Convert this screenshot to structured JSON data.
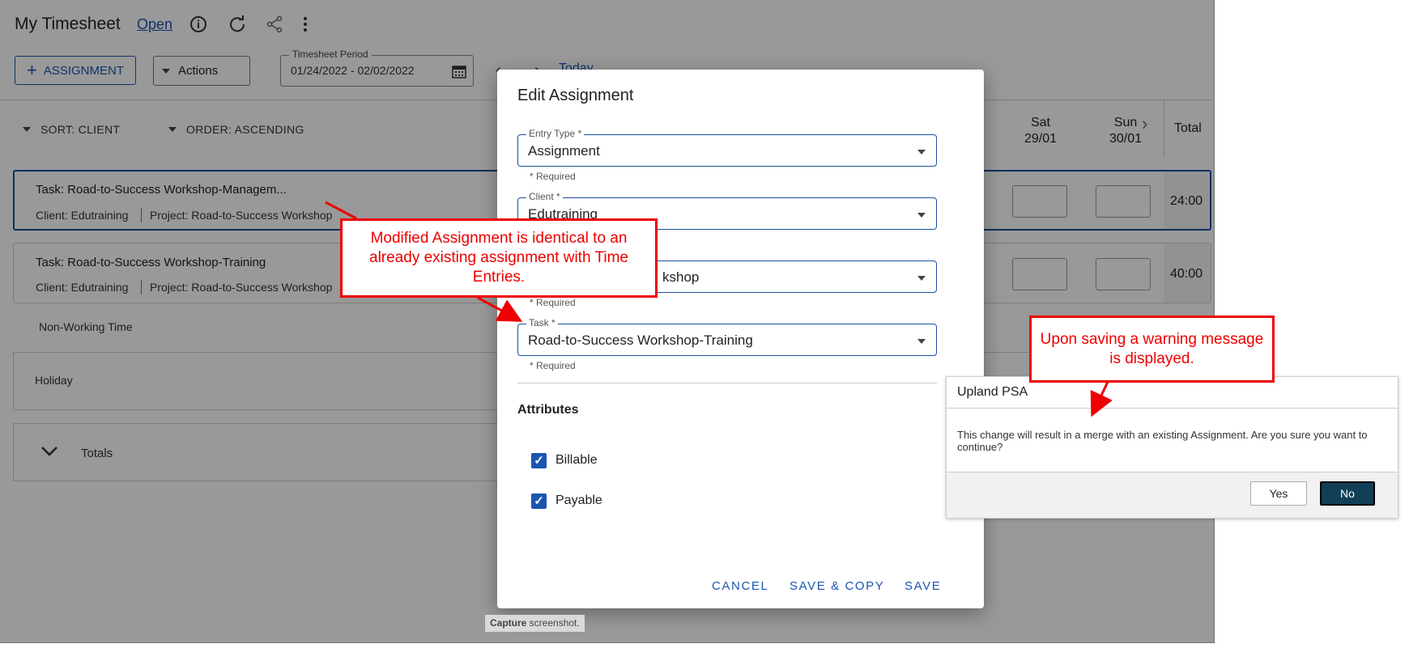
{
  "app": {
    "title": "My Timesheet",
    "status_link": "Open",
    "add_assignment": "ASSIGNMENT",
    "actions": "Actions",
    "period_label": "Timesheet Period",
    "period_value": "01/24/2022 - 02/02/2022",
    "today": "Today",
    "sort": "SORT: CLIENT",
    "order": "ORDER: ASCENDING",
    "columns": [
      {
        "day": "Sat",
        "date": "29/01"
      },
      {
        "day": "Sun",
        "date": "30/01"
      }
    ],
    "total_header": "Total",
    "rows": [
      {
        "task": "Task: Road-to-Success Workshop-Managem...",
        "client": "Client: Edutraining",
        "project": "Project: Road-to-Success Workshop",
        "total": "24:00"
      },
      {
        "task": "Task: Road-to-Success Workshop-Training",
        "client": "Client: Edutraining",
        "project": "Project: Road-to-Success Workshop",
        "total": "40:00"
      }
    ],
    "non_working": "Non-Working Time",
    "holiday": "Holiday",
    "totals": "Totals"
  },
  "dialog": {
    "title": "Edit Assignment",
    "entry_type_label": "Entry Type *",
    "entry_type_value": "Assignment",
    "client_label": "Client *",
    "client_value": "Edutraining",
    "project_value_visible": "kshop",
    "task_label": "Task *",
    "task_value": "Road-to-Success Workshop-Training",
    "required": "* Required",
    "attributes": "Attributes",
    "billable": "Billable",
    "payable": "Payable",
    "cancel": "CANCEL",
    "save_copy": "SAVE & COPY",
    "save": "SAVE"
  },
  "capture": {
    "bold": "Capture",
    "rest": " screenshot."
  },
  "warning": {
    "title": "Upland PSA",
    "message": "This change will result in a merge with an existing Assignment. Are you sure you want to continue?",
    "yes": "Yes",
    "no": "No"
  },
  "callouts": {
    "left": "Modified Assignment is identical to an already existing assignment with Time Entries.",
    "right": "Upon saving a warning message is displayed."
  },
  "colors": {
    "accent": "#1a56b0",
    "callout": "#ee0000",
    "no_button": "#123f57"
  }
}
